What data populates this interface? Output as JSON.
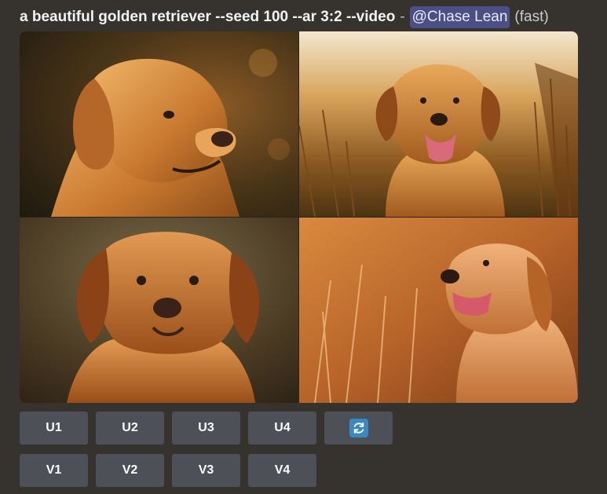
{
  "message": {
    "prompt": "a beautiful golden retriever --seed 100 --ar 3:2 --video",
    "separator": "-",
    "mention": "@Chase Lean",
    "speed": "(fast)"
  },
  "image_grid": {
    "images": [
      {
        "icon": "golden-retriever-portrait-left"
      },
      {
        "icon": "golden-retriever-smiling-field"
      },
      {
        "icon": "golden-retriever-front-portrait"
      },
      {
        "icon": "golden-retriever-tongue-field"
      }
    ]
  },
  "upscale_buttons": [
    {
      "label": "U1"
    },
    {
      "label": "U2"
    },
    {
      "label": "U3"
    },
    {
      "label": "U4"
    }
  ],
  "reroll_button": {
    "icon": "refresh-icon"
  },
  "variation_buttons": [
    {
      "label": "V1"
    },
    {
      "label": "V2"
    },
    {
      "label": "V3"
    },
    {
      "label": "V4"
    }
  ],
  "colors": {
    "background": "#36332f",
    "button": "#4e5058",
    "mention_bg": "#4b4f85",
    "refresh_icon": "#3b88c3"
  }
}
